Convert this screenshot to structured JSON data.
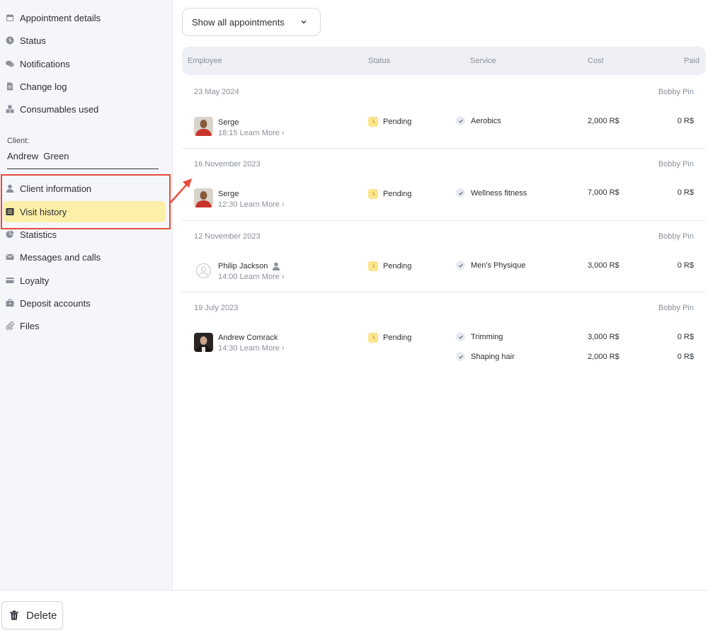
{
  "sidebar": {
    "items_top": [
      {
        "label": "Appointment details",
        "icon": "calendar-icon"
      },
      {
        "label": "Status",
        "icon": "clock-icon"
      },
      {
        "label": "Notifications",
        "icon": "chat-bubbles-icon"
      },
      {
        "label": "Change log",
        "icon": "document-icon"
      },
      {
        "label": "Consumables used",
        "icon": "boxes-icon"
      }
    ],
    "client_label": "Client:",
    "client_name": "Andrew  Green",
    "items_bottom": [
      {
        "label": "Client information",
        "icon": "user-icon"
      },
      {
        "label": "Visit history",
        "icon": "list-icon",
        "active": true
      },
      {
        "label": "Statistics",
        "icon": "pie-chart-icon"
      },
      {
        "label": "Messages and calls",
        "icon": "envelope-icon"
      },
      {
        "label": "Loyalty",
        "icon": "card-icon"
      },
      {
        "label": "Deposit accounts",
        "icon": "briefcase-icon"
      },
      {
        "label": "Files",
        "icon": "paperclip-icon"
      }
    ]
  },
  "filter": {
    "label": "Show all appointments"
  },
  "table": {
    "headers": {
      "employee": "Employee",
      "status": "Status",
      "service": "Service",
      "cost": "Cost",
      "paid": "Paid"
    },
    "groups": [
      {
        "date": "23 May 2024",
        "author": "Bobby Pin",
        "employee": "Serge",
        "time": "18:15",
        "learn_more": "Learn More",
        "status": "Pending",
        "services": [
          {
            "name": "Aerobics",
            "cost": "2,000 R$",
            "paid": "0 R$"
          }
        ]
      },
      {
        "date": "16 November 2023",
        "author": "Bobby Pin",
        "employee": "Serge",
        "time": "12:30",
        "learn_more": "Learn More",
        "status": "Pending",
        "services": [
          {
            "name": "Wellness fitness",
            "cost": "7,000 R$",
            "paid": "0 R$"
          }
        ]
      },
      {
        "date": "12 November 2023",
        "author": "Bobby Pin",
        "employee": "Philip Jackson",
        "time": "14:00",
        "learn_more": "Learn More",
        "status": "Pending",
        "services": [
          {
            "name": "Men's Physique",
            "cost": "3,000 R$",
            "paid": "0 R$"
          }
        ]
      },
      {
        "date": "19 July 2023",
        "author": "Bobby Pin",
        "employee": "Andrew Comrack",
        "time": "14:30",
        "learn_more": "Learn More",
        "status": "Pending",
        "services": [
          {
            "name": "Trimming",
            "cost": "3,000 R$",
            "paid": "0 R$"
          },
          {
            "name": "Shaping hair",
            "cost": "2,000 R$",
            "paid": "0 R$"
          }
        ]
      }
    ]
  },
  "footer": {
    "delete_label": "Delete"
  },
  "colors": {
    "active_bg": "#fcefa8",
    "pending_badge": "#fce58c",
    "annotation_red": "#e74c3c"
  }
}
